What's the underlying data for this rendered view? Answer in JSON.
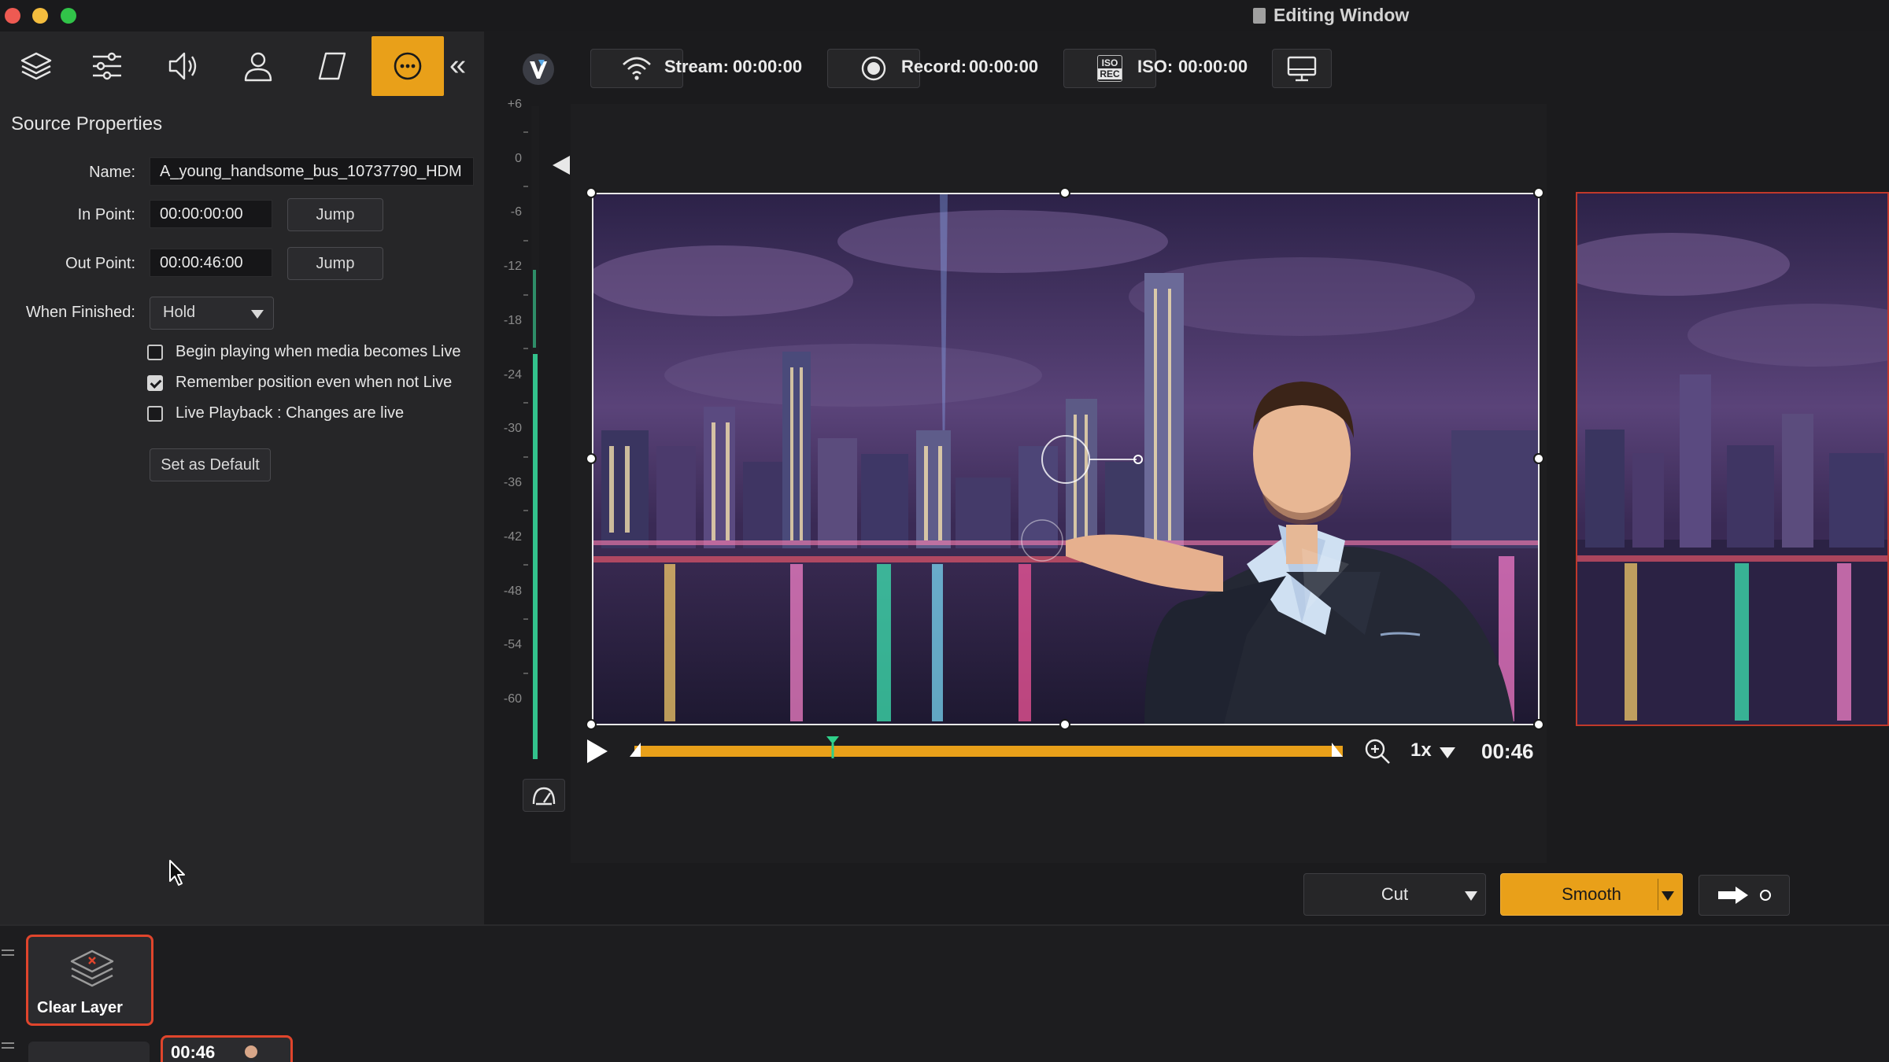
{
  "window": {
    "title": "Editing Window"
  },
  "left_toolbar": {
    "icons": [
      "layers-icon",
      "sliders-icon",
      "speaker-icon",
      "person-icon",
      "crop-icon",
      "more-icon"
    ],
    "active": "more-icon"
  },
  "source_properties": {
    "title": "Source Properties",
    "name_label": "Name:",
    "name_value": "A_young_handsome_bus_10737790_HDM",
    "in_point_label": "In Point:",
    "in_point_value": "00:00:00:00",
    "out_point_label": "Out Point:",
    "out_point_value": "00:00:46:00",
    "jump_label": "Jump",
    "when_finished_label": "When Finished:",
    "when_finished_value": "Hold",
    "checkboxes": [
      {
        "label": "Begin playing when media becomes Live",
        "checked": false
      },
      {
        "label": "Remember position even when not Live",
        "checked": true
      },
      {
        "label": "Live Playback : Changes are live",
        "checked": false
      }
    ],
    "set_default_label": "Set as Default"
  },
  "main_toolbar": {
    "stream_label": "Stream:",
    "stream_time": "00:00:00",
    "record_label": "Record:",
    "record_time": "00:00:00",
    "iso_label": "ISO:",
    "iso_time": "00:00:00",
    "iso_icon_text": "ISO\nREC"
  },
  "audio_meter": {
    "ticks": [
      "+6",
      "0",
      "-6",
      "-12",
      "-18",
      "-24",
      "-30",
      "-36",
      "-42",
      "-48",
      "-54",
      "-60"
    ],
    "level_db": -24,
    "level_fraction": 0.62
  },
  "playback": {
    "speed": "1x",
    "timecode": "00:46",
    "playhead_fraction": 0.28
  },
  "transitions": {
    "cut_label": "Cut",
    "smooth_label": "Smooth"
  },
  "layers": {
    "clear_layer_label": "Clear Layer",
    "media_time": "00:46"
  },
  "colors": {
    "accent": "#e9a019",
    "live": "#e0452c",
    "meter": "#33c28c"
  }
}
